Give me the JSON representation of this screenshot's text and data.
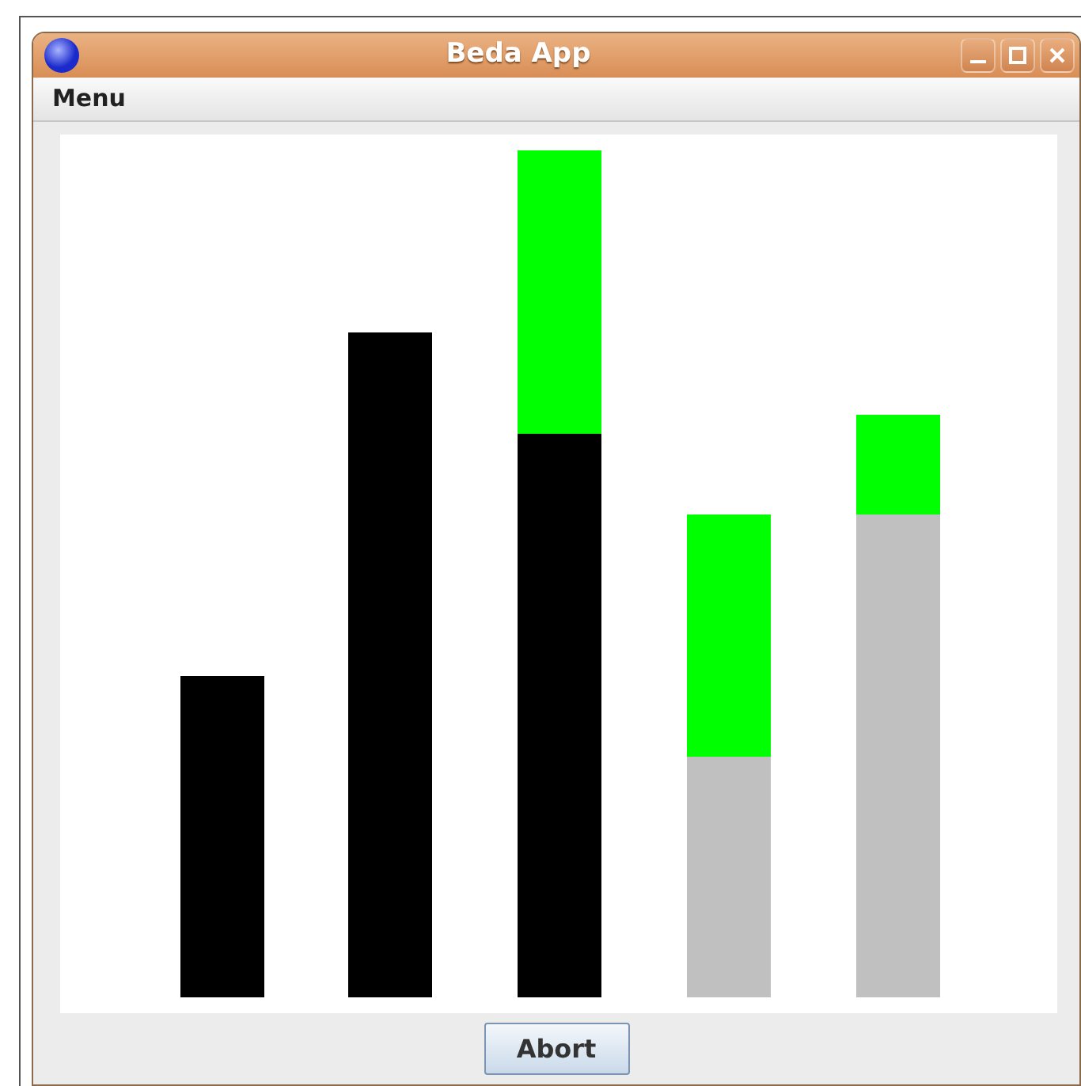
{
  "window": {
    "title": "Beda App"
  },
  "menu_bar": {
    "items": [
      "Menu"
    ]
  },
  "buttons": [
    "Abort"
  ]
}
